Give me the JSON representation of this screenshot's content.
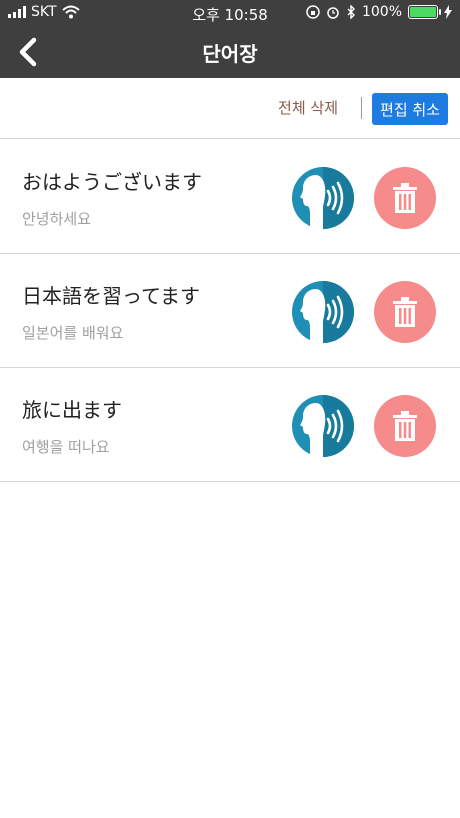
{
  "status_bar": {
    "carrier": "SKT",
    "time": "오후 10:58",
    "battery": "100%",
    "battery_level": 1.0
  },
  "nav": {
    "title": "단어장"
  },
  "toolbar": {
    "delete_all_label": "전체 삭제",
    "cancel_edit_label": "편집 취소"
  },
  "words": [
    {
      "word": "おはようございます",
      "meaning": "안녕하세요"
    },
    {
      "word": "日本語を習ってます",
      "meaning": "일본어를 배워요"
    },
    {
      "word": "旅に出ます",
      "meaning": "여행을 떠나요"
    }
  ],
  "colors": {
    "nav_bg": "#3f3f3f",
    "accent": "#1e7be0",
    "delete_button": "#f68b8b",
    "speak_button": "#1f8fb5"
  },
  "icons": {
    "back": "back-chevron-icon",
    "speak": "speaker-head-icon",
    "delete": "trash-icon"
  }
}
